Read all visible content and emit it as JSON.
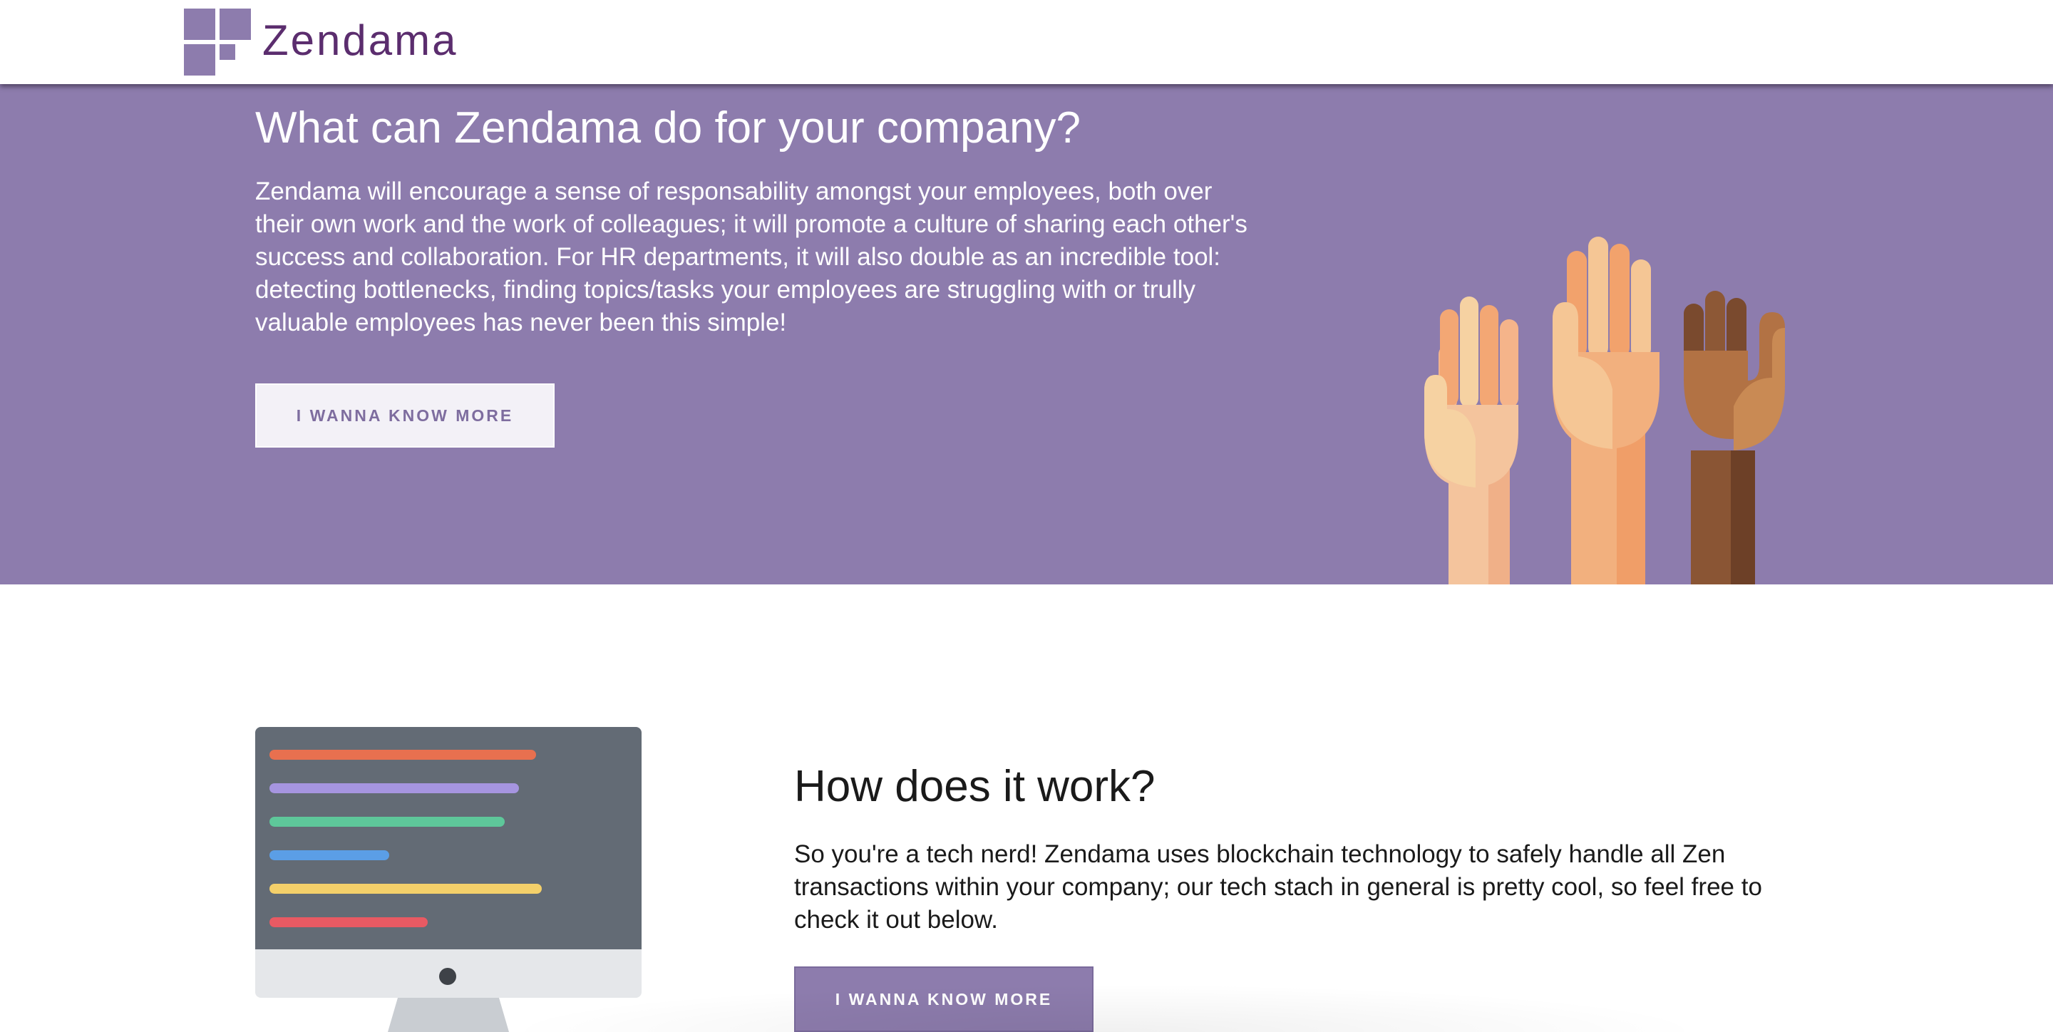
{
  "brand": {
    "name": "Zendama",
    "primary_color": "#8d7cad",
    "brand_text_color": "#5b2d6e"
  },
  "header": {
    "logo_icon": "zendama-squares-logo-icon"
  },
  "hero": {
    "title": "What can Zendama do for your company?",
    "body": "Zendama will encourage a sense of responsability amongst your employees, both over their own work and the work of colleagues; it will promote a culture of sharing each other's success and collaboration. For HR departments, it will also double as an incredible tool: detecting bottlenecks, finding topics/tasks your employees are struggling with or trully valuable employees has never been this simple!",
    "button_label": "I WANNA KNOW MORE",
    "illustration_icon": "raised-hands-icon"
  },
  "how": {
    "title": "How does it work?",
    "body": "So you're a tech nerd! Zendama uses blockchain technology to safely handle all Zen transactions within your company; our tech stach in general is pretty cool, so feel free to check it out below.",
    "button_label": "I WANNA KNOW MORE",
    "illustration_icon": "code-monitor-icon"
  }
}
